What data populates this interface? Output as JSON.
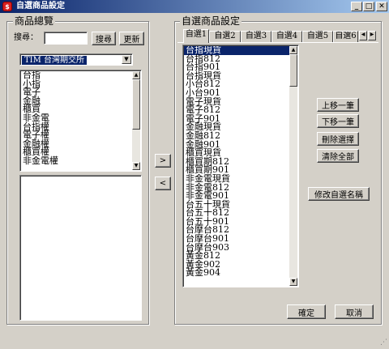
{
  "window": {
    "title": "自選商品設定",
    "app_icon": "app-icon"
  },
  "left_group": {
    "title": "商品總覽",
    "search_label": "搜尋：",
    "search_value": "",
    "search_button": "搜尋",
    "refresh_button": "更新",
    "exchange_selected": "TIM  台灣期交所",
    "products": [
      "台指",
      "小指",
      "電子",
      "金融",
      "櫃買",
      "非金電",
      "台指權",
      "電子權",
      "金融權",
      "櫃買權",
      "非金電權"
    ]
  },
  "transfer": {
    "add": ">",
    "remove": "<"
  },
  "right_group": {
    "title": "自選商品設定",
    "tabs": [
      "自選1",
      "自選2",
      "自選3",
      "自選4",
      "自選5",
      "自選6"
    ],
    "items": [
      "台指現貨",
      "台指812",
      "台指901",
      "台指現貨",
      "小台812",
      "小台901",
      "電子現貨",
      "電子812",
      "電子901",
      "金融現貨",
      "金融812",
      "金融901",
      "櫃買現貨",
      "櫃買期812",
      "櫃買期901",
      "非金電現貨",
      "非金電812",
      "非金電901",
      "台五十現貨",
      "台五十812",
      "台五十901",
      "台摩台812",
      "台摩台901",
      "台摩台903",
      "黃金812",
      "黃金902",
      "黃金904"
    ],
    "move_up": "上移一筆",
    "move_down": "下移一筆",
    "delete_selected": "刪除選擇",
    "clear_all": "清除全部",
    "rename": "修改自選名稱"
  },
  "footer": {
    "ok": "確定",
    "cancel": "取消"
  }
}
